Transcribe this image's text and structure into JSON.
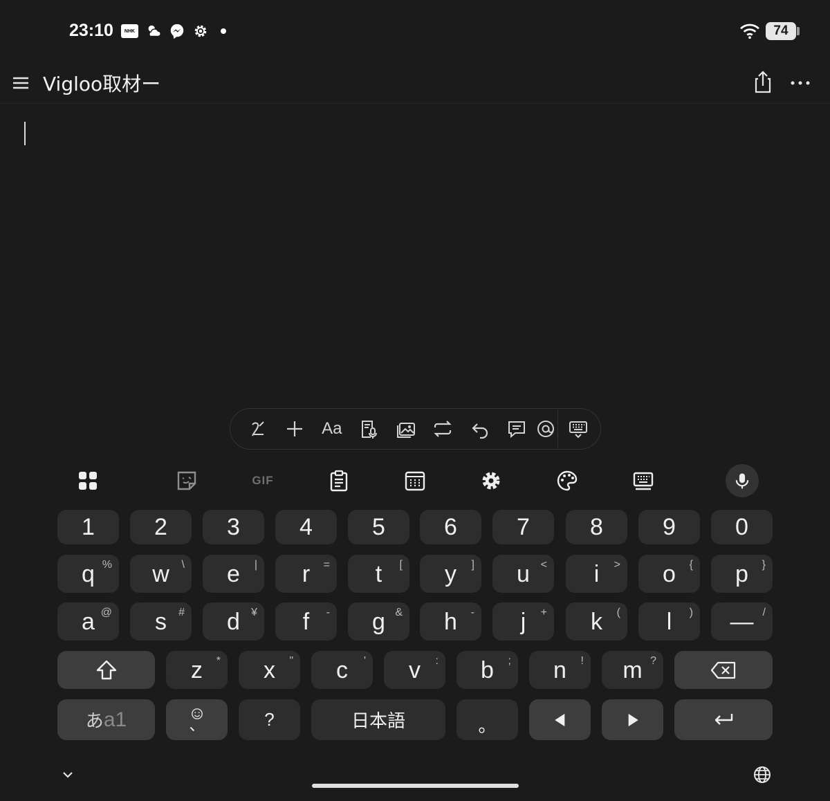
{
  "status_bar": {
    "time": "23:10",
    "nhk_label": "NHK",
    "battery": "74",
    "icons": [
      "nhk-icon",
      "weather-icon",
      "messenger-icon",
      "settings-icon",
      "notification-dot",
      "wifi-icon",
      "battery-icon"
    ]
  },
  "app_bar": {
    "title": "Vigloo取材ー",
    "icons": [
      "menu-icon",
      "share-icon",
      "more-icon"
    ]
  },
  "editor": {
    "content": ""
  },
  "toolbar": {
    "aa_label": "Aa",
    "icons": [
      "handwriting-icon",
      "plus-icon",
      "text-format-icon",
      "voice-record-icon",
      "image-icon",
      "convert-icon",
      "undo-icon",
      "comment-icon",
      "mention-icon",
      "keyboard-icon"
    ]
  },
  "keyboard": {
    "tools": {
      "gif_label": "GIF",
      "icons": [
        "apps-icon",
        "sticker-icon",
        "gif-icon",
        "clipboard-icon",
        "numpad-icon",
        "settings-icon",
        "theme-icon",
        "keyboard-size-icon",
        "mic-icon"
      ]
    },
    "rows": [
      [
        {
          "k": "1",
          "s": ""
        },
        {
          "k": "2",
          "s": ""
        },
        {
          "k": "3",
          "s": ""
        },
        {
          "k": "4",
          "s": ""
        },
        {
          "k": "5",
          "s": ""
        },
        {
          "k": "6",
          "s": ""
        },
        {
          "k": "7",
          "s": ""
        },
        {
          "k": "8",
          "s": ""
        },
        {
          "k": "9",
          "s": ""
        },
        {
          "k": "0",
          "s": ""
        }
      ],
      [
        {
          "k": "q",
          "s": "%"
        },
        {
          "k": "w",
          "s": "\\"
        },
        {
          "k": "e",
          "s": "|"
        },
        {
          "k": "r",
          "s": "="
        },
        {
          "k": "t",
          "s": "["
        },
        {
          "k": "y",
          "s": "]"
        },
        {
          "k": "u",
          "s": "<"
        },
        {
          "k": "i",
          "s": ">"
        },
        {
          "k": "o",
          "s": "{"
        },
        {
          "k": "p",
          "s": "}"
        }
      ],
      [
        {
          "k": "a",
          "s": "@"
        },
        {
          "k": "s",
          "s": "#"
        },
        {
          "k": "d",
          "s": "¥"
        },
        {
          "k": "f",
          "s": "-"
        },
        {
          "k": "g",
          "s": "&"
        },
        {
          "k": "h",
          "s": "-"
        },
        {
          "k": "j",
          "s": "+"
        },
        {
          "k": "k",
          "s": "("
        },
        {
          "k": "l",
          "s": ")"
        },
        {
          "k": "—",
          "s": "/"
        }
      ],
      [
        {
          "k": "z",
          "s": "*"
        },
        {
          "k": "x",
          "s": "\""
        },
        {
          "k": "c",
          "s": "'"
        },
        {
          "k": "v",
          "s": ":"
        },
        {
          "k": "b",
          "s": ";"
        },
        {
          "k": "n",
          "s": "!"
        },
        {
          "k": "m",
          "s": "?"
        }
      ]
    ],
    "shift_icon": "shift-icon",
    "backspace_icon": "backspace-icon",
    "mode_label_kana": "あ",
    "mode_label_alpha": "a1",
    "emoji_key_bottom": "、",
    "question_key": "?",
    "space_label": "日本語",
    "period_key": "。",
    "left_arrow_icon": "cursor-left-icon",
    "right_arrow_icon": "cursor-right-icon",
    "enter_icon": "enter-icon"
  },
  "bottom": {
    "icons": [
      "hide-keyboard-icon",
      "globe-icon"
    ]
  }
}
